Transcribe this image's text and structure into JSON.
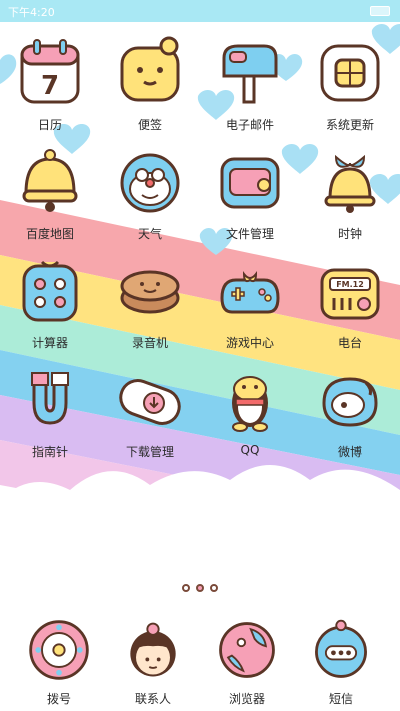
{
  "status_bar": {
    "time": "下午4:20"
  },
  "apps": [
    {
      "label": "日历"
    },
    {
      "label": "便签"
    },
    {
      "label": "电子邮件"
    },
    {
      "label": "系统更新"
    },
    {
      "label": "百度地图"
    },
    {
      "label": "天气"
    },
    {
      "label": "文件管理"
    },
    {
      "label": "时钟"
    },
    {
      "label": "计算器"
    },
    {
      "label": "录音机"
    },
    {
      "label": "游戏中心"
    },
    {
      "label": "电台"
    },
    {
      "label": "指南针"
    },
    {
      "label": "下载管理"
    },
    {
      "label": "QQ"
    },
    {
      "label": "微博"
    }
  ],
  "icon_text": {
    "calendar_day": "7",
    "radio_freq": "FM.12"
  },
  "page_indicator": {
    "count": 3,
    "active": 1
  },
  "dock": [
    {
      "label": "拨号"
    },
    {
      "label": "联系人"
    },
    {
      "label": "浏览器"
    },
    {
      "label": "短信"
    }
  ],
  "colors": {
    "status_bar": "#a9e8f4",
    "sky": "#ffffff",
    "outline": "#5a3526",
    "yellow": "#ffe27a",
    "blue": "#7ecff0",
    "pink": "#f6a0b6"
  }
}
